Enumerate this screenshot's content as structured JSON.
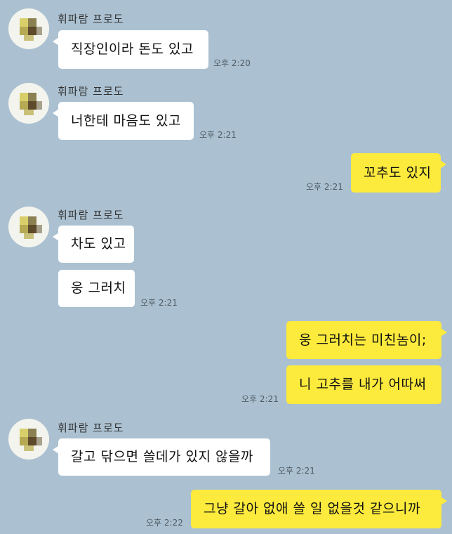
{
  "chat": {
    "sender_name": "휘파람 프로도",
    "messages": [
      {
        "direction": "incoming",
        "text": "직장인이라 돈도 있고",
        "time": "오후 2:20"
      },
      {
        "direction": "incoming",
        "text": "너한테 마음도 있고",
        "time": "오후 2:21"
      },
      {
        "direction": "outgoing",
        "text": "꼬추도 있지",
        "time": "오후 2:21"
      },
      {
        "direction": "incoming",
        "text": "차도 있고",
        "time": ""
      },
      {
        "direction": "incoming",
        "text": "웅 그러치",
        "time": "오후 2:21"
      },
      {
        "direction": "outgoing",
        "text": "웅 그러치는 미친놈이;",
        "time": ""
      },
      {
        "direction": "outgoing",
        "text": "니 고추를 내가 어따써",
        "time": "오후 2:21"
      },
      {
        "direction": "incoming",
        "text": "갈고 닦으면 쓸데가 있지 않을까",
        "time": "오후 2:21"
      },
      {
        "direction": "outgoing",
        "text": "그냥 갈아 없애 쓸 일 없을것 같으니까",
        "time": "오후 2:22"
      }
    ]
  },
  "colors": {
    "background": "#abc1d1",
    "incoming_bubble": "#ffffff",
    "outgoing_bubble": "#fcea3d"
  }
}
